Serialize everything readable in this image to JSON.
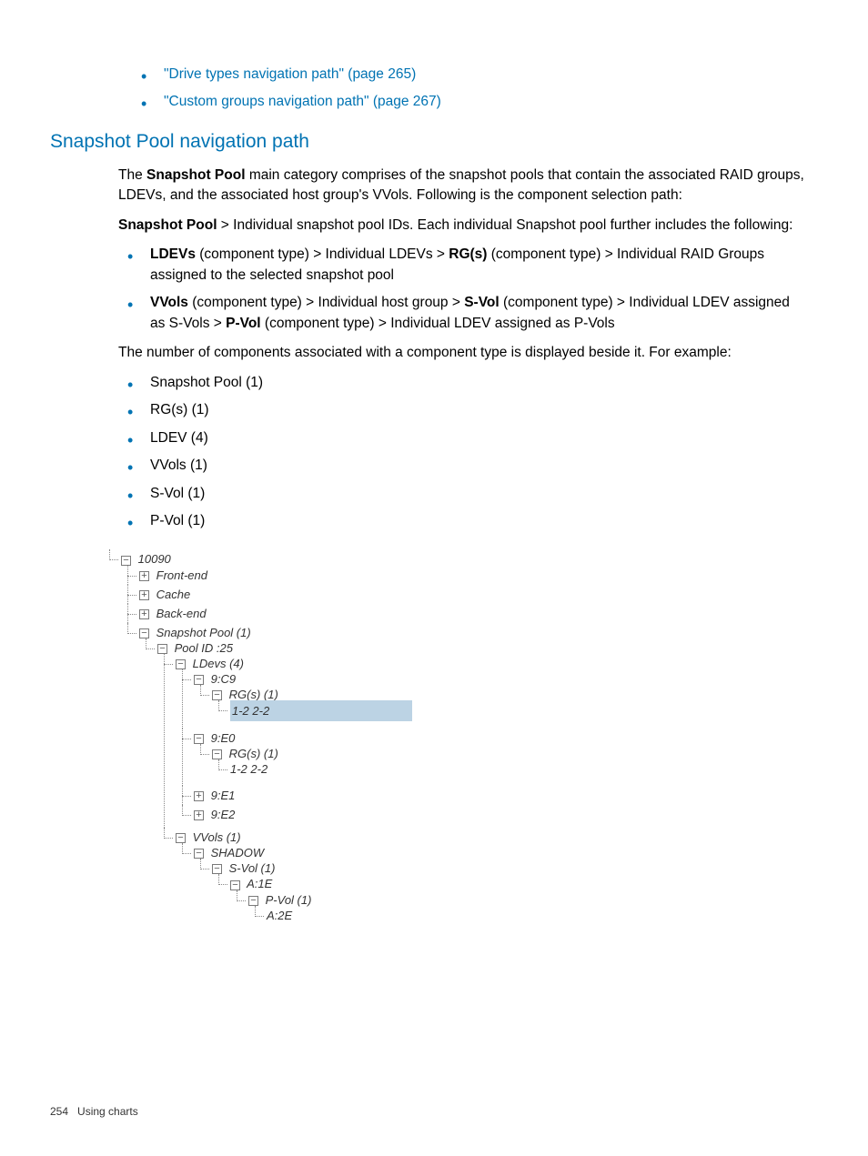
{
  "topLinks": {
    "link1": "\"Drive types navigation path\" (page 265)",
    "link2": "\"Custom groups navigation path\" (page 267)"
  },
  "heading": "Snapshot Pool navigation path",
  "para1_a": "The ",
  "para1_bold": "Snapshot Pool",
  "para1_b": " main category comprises of the snapshot pools that contain the associated RAID groups, LDEVs, and the associated host group's VVols. Following is the component selection path:",
  "para2_bold": "Snapshot Pool",
  "para2_rest": " > Individual snapshot pool IDs. Each individual Snapshot pool further includes the following:",
  "detail1_bold1": "LDEVs",
  "detail1_mid": " (component type) > Individual LDEVs > ",
  "detail1_bold2": "RG(s)",
  "detail1_end": " (component type) > Individual RAID Groups assigned to the selected snapshot pool",
  "detail2_bold1": "VVols",
  "detail2_a": " (component type) > Individual host group > ",
  "detail2_bold2": "S-Vol",
  "detail2_b": " (component type) > Individual LDEV assigned as S-Vols > ",
  "detail2_bold3": "P-Vol",
  "detail2_c": " (component type) > Individual LDEV assigned as P-Vols",
  "para3": "The number of components associated with a component type is displayed beside it. For example:",
  "examples": {
    "e1": "Snapshot Pool (1)",
    "e2": "RG(s) (1)",
    "e3": "LDEV (4)",
    "e4": "VVols (1)",
    "e5": "S-Vol (1)",
    "e6": "P-Vol (1)"
  },
  "tree": {
    "root": "10090",
    "frontend": "Front-end",
    "cache": "Cache",
    "backend": "Back-end",
    "snapshot": "Snapshot Pool (1)",
    "pool": "Pool ID :25",
    "ldevs": "LDevs (4)",
    "n9c9": "9:C9",
    "rgs1": "RG(s) (1)",
    "leaf1": "1-2 2-2",
    "n9e0": "9:E0",
    "rgs2": "RG(s) (1)",
    "leaf2": "1-2 2-2",
    "n9e1": "9:E1",
    "n9e2": "9:E2",
    "vvols": "VVols (1)",
    "shadow": "SHADOW",
    "svol": "S-Vol (1)",
    "a1e": "A:1E",
    "pvol": "P-Vol (1)",
    "a2e": "A:2E"
  },
  "toggles": {
    "minus": "−",
    "plus": "+"
  },
  "footer": {
    "page": "254",
    "label": "Using charts"
  }
}
